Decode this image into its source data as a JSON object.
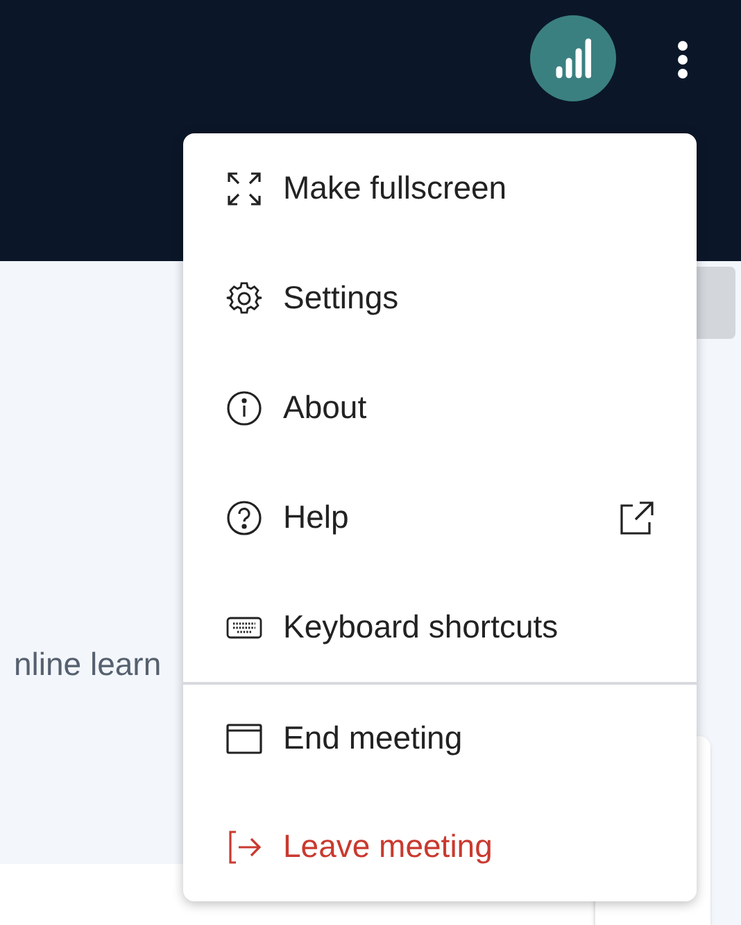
{
  "page": {
    "text_fragment": "nline learn"
  },
  "menu": {
    "items": [
      {
        "label": "Make fullscreen",
        "external": false,
        "danger": false,
        "divider_before": false
      },
      {
        "label": "Settings",
        "external": false,
        "danger": false,
        "divider_before": false
      },
      {
        "label": "About",
        "external": false,
        "danger": false,
        "divider_before": false
      },
      {
        "label": "Help",
        "external": true,
        "danger": false,
        "divider_before": false
      },
      {
        "label": "Keyboard shortcuts",
        "external": false,
        "danger": false,
        "divider_before": false
      },
      {
        "label": "End meeting",
        "external": false,
        "danger": false,
        "divider_before": true
      },
      {
        "label": "Leave meeting",
        "external": false,
        "danger": true,
        "divider_before": false
      }
    ]
  }
}
